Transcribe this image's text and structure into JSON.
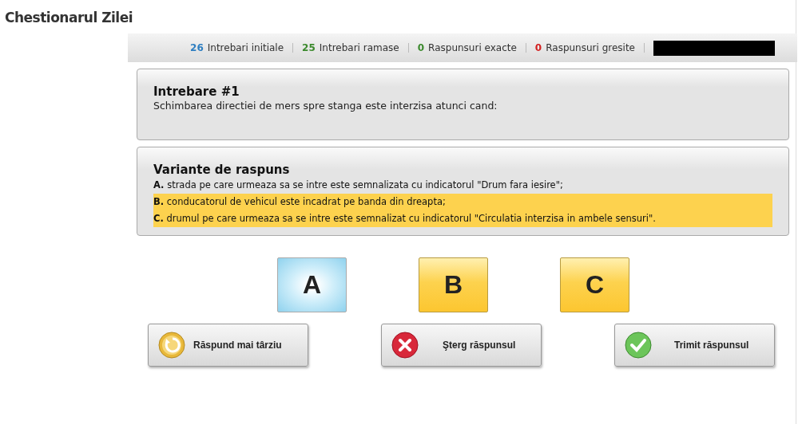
{
  "page_title": "Chestionarul Zilei",
  "stats": [
    {
      "count": "26",
      "label": "Intrebari initiale",
      "color": "#2f7fc1"
    },
    {
      "count": "25",
      "label": "Intrebari ramase",
      "color": "#3c8a2e"
    },
    {
      "count": "0",
      "label": "Raspunsuri exacte",
      "color": "#3c8a2e"
    },
    {
      "count": "0",
      "label": "Raspunsuri gresite",
      "color": "#d32020"
    }
  ],
  "question": {
    "title": "Intrebare #1",
    "text": "Schimbarea directiei de mers spre stanga este interzisa atunci cand:"
  },
  "answers": {
    "title": "Variante de raspuns",
    "options": [
      {
        "letter": "A.",
        "text": "strada pe care urmeaza sa se intre este semnalizata cu indicatorul \"Drum fara iesire\";",
        "selected": false
      },
      {
        "letter": "B.",
        "text": "conducatorul de vehicul este incadrat pe banda din dreapta;",
        "selected": true
      },
      {
        "letter": "C.",
        "text": "drumul pe care urmeaza sa se intre este semnalizat cu indicatorul \"Circulatia interzisa in ambele sensuri\".",
        "selected": true
      }
    ]
  },
  "letter_buttons": [
    {
      "label": "A",
      "selected": false
    },
    {
      "label": "B",
      "selected": true
    },
    {
      "label": "C",
      "selected": true
    }
  ],
  "actions": [
    {
      "kind": "later",
      "label": "Răspund mai târziu"
    },
    {
      "kind": "clear",
      "label": "Şterg răspunsul"
    },
    {
      "kind": "submit",
      "label": "Trimit răspunsul"
    }
  ]
}
